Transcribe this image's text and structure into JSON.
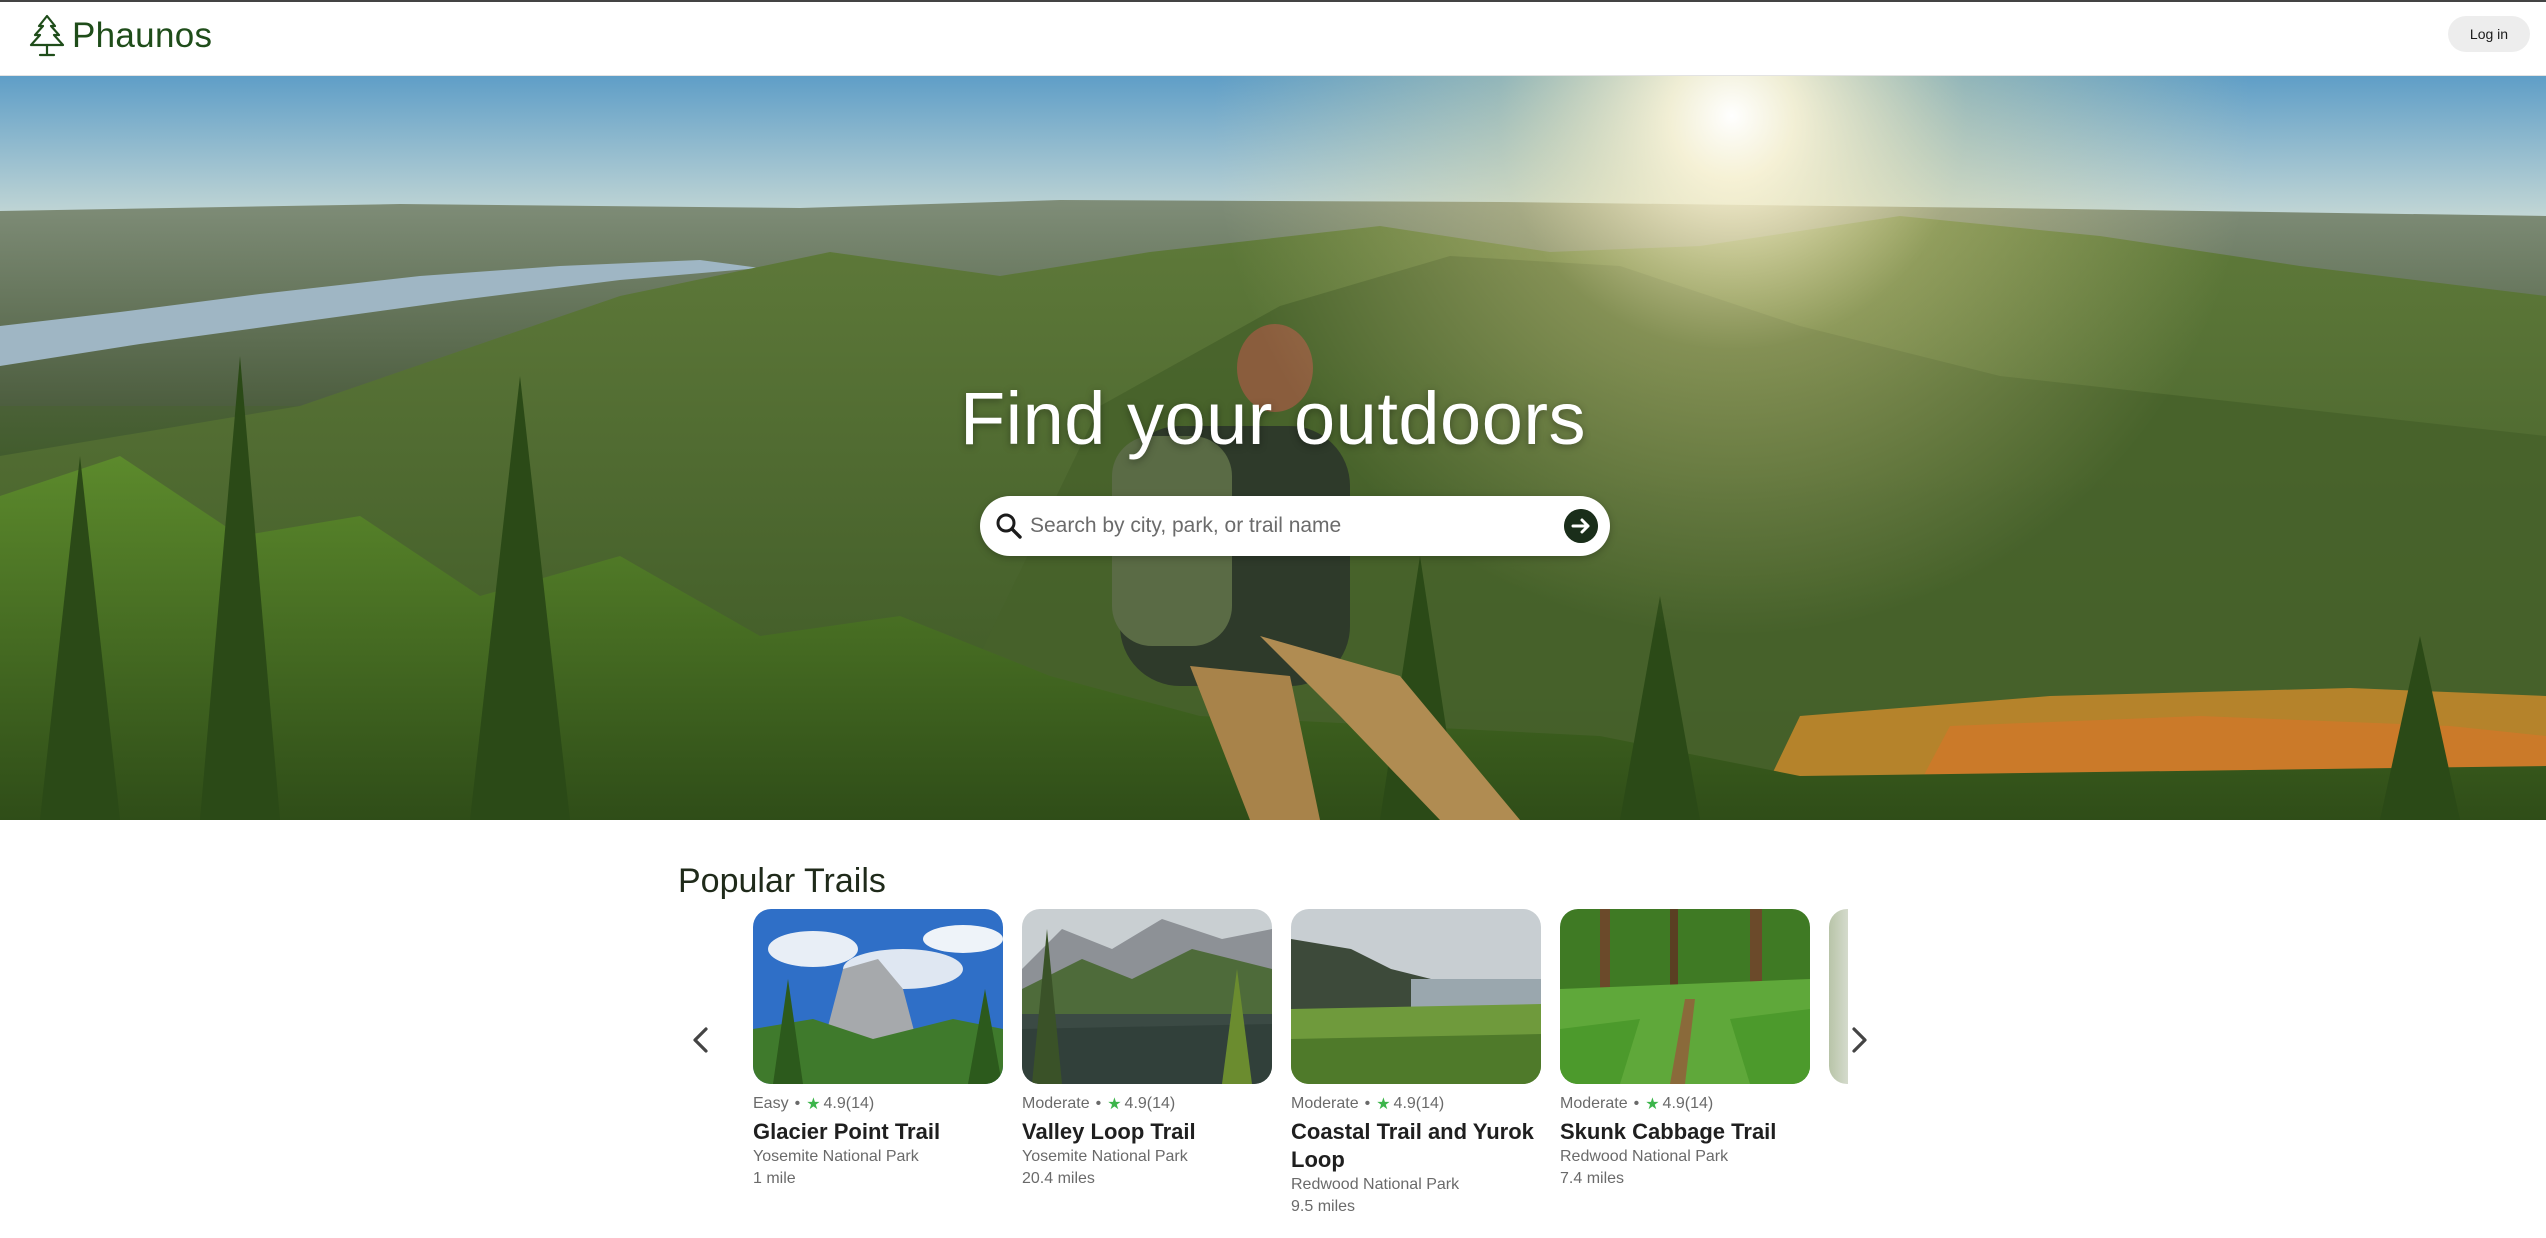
{
  "app": {
    "name": "Phaunos"
  },
  "header": {
    "login_label": "Log in"
  },
  "hero": {
    "title": "Find your outdoors",
    "search_placeholder": "Search by city, park, or trail name"
  },
  "popular": {
    "title": "Popular Trails",
    "trails": [
      {
        "difficulty": "Easy",
        "rating": "4.9",
        "count": "(14)",
        "name": "Glacier Point Trail",
        "park": "Yosemite National Park",
        "length": "1 mile"
      },
      {
        "difficulty": "Moderate",
        "rating": "4.9",
        "count": "(14)",
        "name": "Valley Loop Trail",
        "park": "Yosemite National Park",
        "length": "20.4 miles"
      },
      {
        "difficulty": "Moderate",
        "rating": "4.9",
        "count": "(14)",
        "name": "Coastal Trail and Yurok Loop",
        "park": "Redwood National Park",
        "length": "9.5 miles"
      },
      {
        "difficulty": "Moderate",
        "rating": "4.9",
        "count": "(14)",
        "name": "Skunk Cabbage Trail",
        "park": "Redwood National Park",
        "length": "7.4 miles"
      }
    ]
  },
  "colors": {
    "brand": "#1f4d1a",
    "star": "#3bb54a",
    "search_button": "#1a2e1a"
  },
  "icons": {
    "logo": "pine-tree-icon",
    "search": "magnifier-icon",
    "go": "arrow-right-circle-icon",
    "prev": "chevron-left-icon",
    "next": "chevron-right-icon",
    "rating": "star-icon"
  }
}
